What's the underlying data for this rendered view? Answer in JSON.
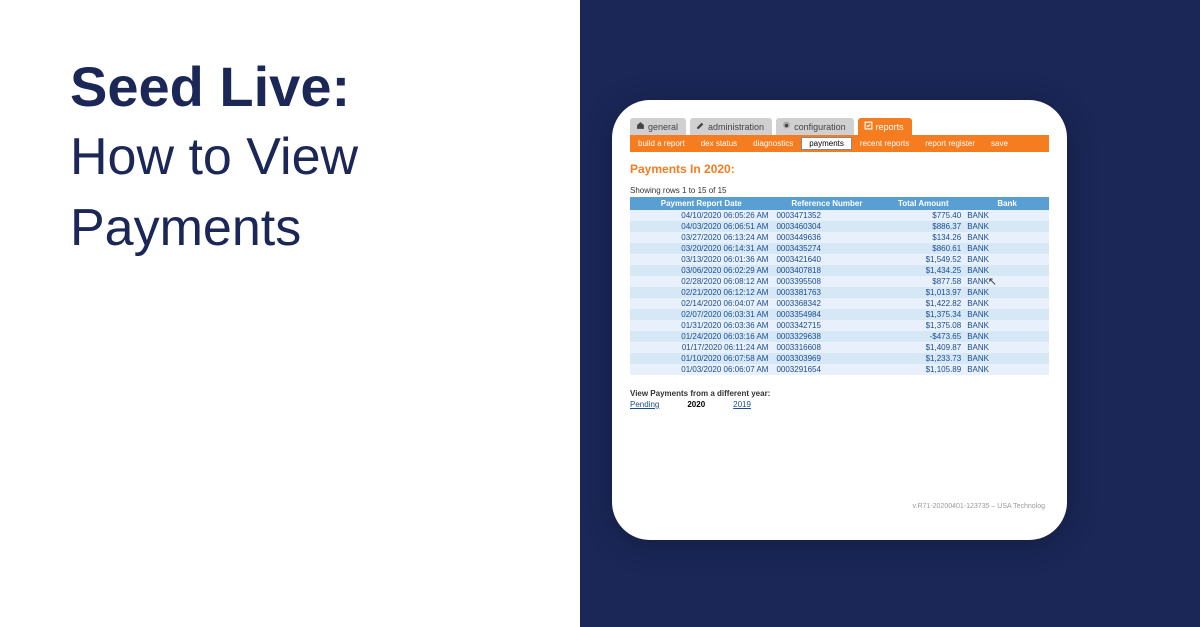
{
  "hero": {
    "title": "Seed Live:",
    "subtitle_line1": "How to View",
    "subtitle_line2": "Payments"
  },
  "topTabs": [
    {
      "label": "general",
      "icon": "home-icon",
      "active": false
    },
    {
      "label": "administration",
      "icon": "edit-icon",
      "active": false
    },
    {
      "label": "configuration",
      "icon": "gear-icon",
      "active": false
    },
    {
      "label": "reports",
      "icon": "check-icon",
      "active": true
    }
  ],
  "subnav": [
    {
      "label": "build a report",
      "active": false
    },
    {
      "label": "dex status",
      "active": false
    },
    {
      "label": "diagnostics",
      "active": false
    },
    {
      "label": "payments",
      "active": true
    },
    {
      "label": "recent reports",
      "active": false
    },
    {
      "label": "report register",
      "active": false
    },
    {
      "label": "save",
      "active": false
    }
  ],
  "page": {
    "title": "Payments In 2020:",
    "showing": "Showing rows 1 to 15 of 15"
  },
  "columns": {
    "c0": "Payment Report Date",
    "c1": "Reference Number",
    "c2": "Total Amount",
    "c3": "Bank"
  },
  "rows": [
    {
      "date": "04/10/2020 06:05:26 AM",
      "ref": "0003471352",
      "amount": "$775.40",
      "bank": "BANK"
    },
    {
      "date": "04/03/2020 06:06:51 AM",
      "ref": "0003460304",
      "amount": "$886.37",
      "bank": "BANK"
    },
    {
      "date": "03/27/2020 06:13:24 AM",
      "ref": "0003449636",
      "amount": "$134.26",
      "bank": "BANK"
    },
    {
      "date": "03/20/2020 06:14:31 AM",
      "ref": "0003435274",
      "amount": "$860.61",
      "bank": "BANK"
    },
    {
      "date": "03/13/2020 06:01:36 AM",
      "ref": "0003421640",
      "amount": "$1,549.52",
      "bank": "BANK"
    },
    {
      "date": "03/06/2020 06:02:29 AM",
      "ref": "0003407818",
      "amount": "$1,434.25",
      "bank": "BANK"
    },
    {
      "date": "02/28/2020 06:08:12 AM",
      "ref": "0003395508",
      "amount": "$877.58",
      "bank": "BANK"
    },
    {
      "date": "02/21/2020 06:12:12 AM",
      "ref": "0003381763",
      "amount": "$1,013.97",
      "bank": "BANK"
    },
    {
      "date": "02/14/2020 06:04:07 AM",
      "ref": "0003368342",
      "amount": "$1,422.82",
      "bank": "BANK"
    },
    {
      "date": "02/07/2020 06:03:31 AM",
      "ref": "0003354984",
      "amount": "$1,375.34",
      "bank": "BANK"
    },
    {
      "date": "01/31/2020 06:03:36 AM",
      "ref": "0003342715",
      "amount": "$1,375.08",
      "bank": "BANK"
    },
    {
      "date": "01/24/2020 06:03:16 AM",
      "ref": "0003329638",
      "amount": "-$473.65",
      "bank": "BANK"
    },
    {
      "date": "01/17/2020 06:11:24 AM",
      "ref": "0003316608",
      "amount": "$1,409.87",
      "bank": "BANK"
    },
    {
      "date": "01/10/2020 06:07:58 AM",
      "ref": "0003303969",
      "amount": "$1,233.73",
      "bank": "BANK"
    },
    {
      "date": "01/03/2020 06:06:07 AM",
      "ref": "0003291654",
      "amount": "$1,105.89",
      "bank": "BANK"
    }
  ],
  "yearSwitch": {
    "label": "View Payments from a different year:",
    "options": [
      {
        "label": "Pending",
        "type": "link"
      },
      {
        "label": "2020",
        "type": "current"
      },
      {
        "label": "2019",
        "type": "link"
      }
    ]
  },
  "footer": {
    "version": "v.R71-20200401-123735 – USA Technolog"
  }
}
